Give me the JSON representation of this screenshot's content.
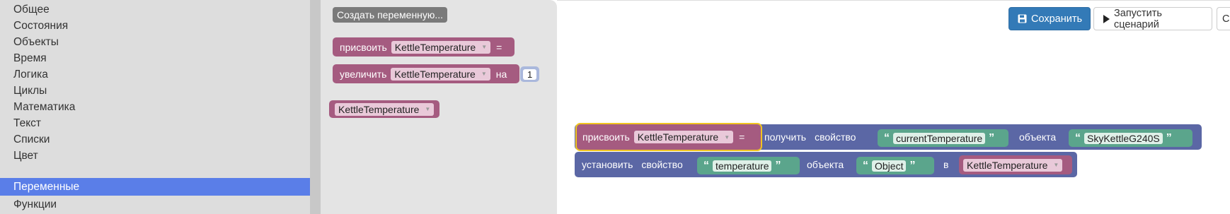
{
  "toolbox": {
    "items": [
      {
        "label": "Общее"
      },
      {
        "label": "Состояния"
      },
      {
        "label": "Объекты"
      },
      {
        "label": "Время"
      },
      {
        "label": "Логика"
      },
      {
        "label": "Циклы"
      },
      {
        "label": "Математика"
      },
      {
        "label": "Текст"
      },
      {
        "label": "Списки"
      },
      {
        "label": "Цвет"
      },
      {
        "label": "Переменные"
      },
      {
        "label": "Функции"
      }
    ],
    "selected": "Переменные",
    "selected_color": "#5a7ee8"
  },
  "flyout": {
    "create_variable_label": "Создать переменную...",
    "set_block": {
      "label": "присвоить",
      "variable": "KettleTemperature",
      "op": "="
    },
    "increment_block": {
      "label": "увеличить",
      "variable": "KettleTemperature",
      "by": "на",
      "value": "1"
    },
    "getter_block": {
      "variable": "KettleTemperature"
    }
  },
  "workspace": {
    "set_block": {
      "label": "присвоить",
      "variable": "KettleTemperature",
      "op": "="
    },
    "get_property_block": {
      "label1": "получить",
      "label2": "свойство",
      "property": "currentTemperature",
      "of": "объекта",
      "object": "SkyKettleG240S"
    },
    "set_property_block": {
      "label1": "установить",
      "label2": "свойство",
      "property": "temperature",
      "of": "объекта",
      "object": "Object",
      "to": "в",
      "variable": "KettleTemperature"
    }
  },
  "toolbar": {
    "save_label": "Сохранить",
    "run_label": "Запустить сценарий",
    "partial_label": "С"
  },
  "colors": {
    "variable_block": "#a55b80",
    "object_block": "#5b67a5",
    "text_block": "#5ba58c",
    "primary_button": "#337ab7"
  },
  "icons": {
    "save": "floppy-disk-icon",
    "run": "play-icon"
  }
}
